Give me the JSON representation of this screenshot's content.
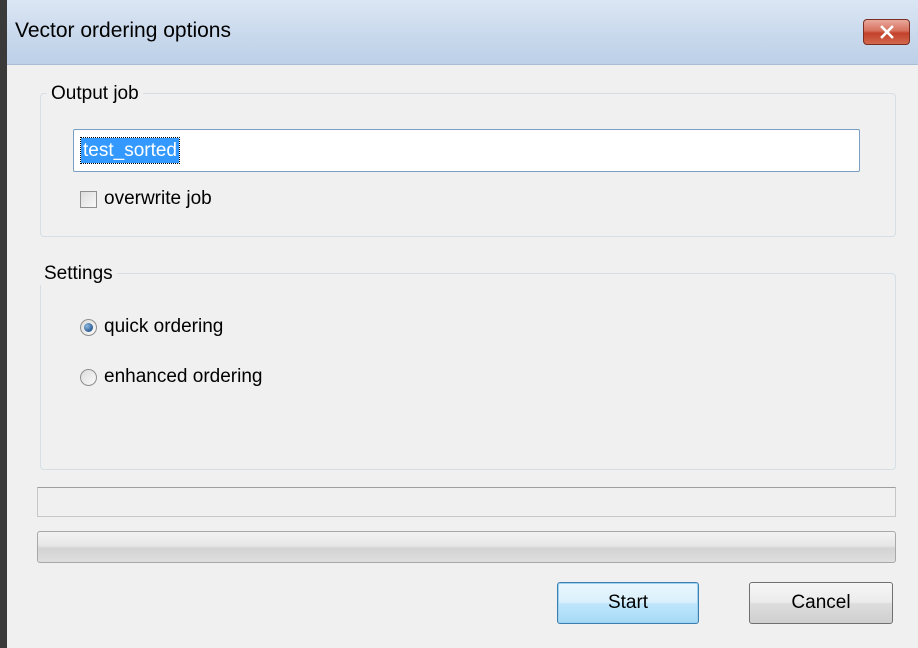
{
  "window": {
    "title": "Vector ordering options",
    "close_icon": "close-x-icon"
  },
  "output_job": {
    "legend": "Output job",
    "job_name_value": "test_sorted",
    "overwrite_label": "overwrite job",
    "overwrite_checked": false
  },
  "settings": {
    "legend": "Settings",
    "options": [
      {
        "label": "quick ordering",
        "checked": true
      },
      {
        "label": "enhanced ordering",
        "checked": false
      }
    ]
  },
  "status": {
    "text": "",
    "progress": 0
  },
  "buttons": {
    "start_label": "Start",
    "cancel_label": "Cancel"
  }
}
